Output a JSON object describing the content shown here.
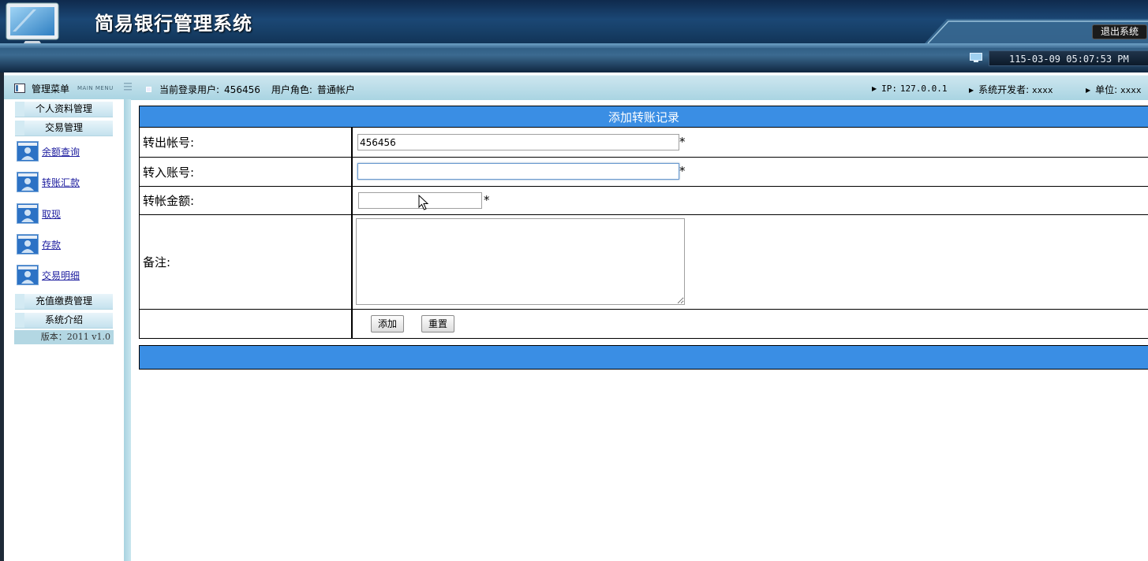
{
  "header": {
    "title": "简易银行管理系统",
    "logout_label": "退出系统",
    "datetime": "115-03-09 05:07:53 PM"
  },
  "infobar": {
    "menu_title": "管理菜单",
    "menu_title_en": "MAIN MENU",
    "current_user_label": "当前登录用户:",
    "current_user": "456456",
    "role_label": "用户角色:",
    "role": "普通帐户",
    "ip_label": "IP:",
    "ip": "127.0.0.1",
    "developer_label": "系统开发者:",
    "developer": "xxxx",
    "unit_label": "单位:",
    "unit": "xxxx"
  },
  "sidebar": {
    "categories": [
      {
        "label": "个人资料管理"
      },
      {
        "label": "交易管理"
      },
      {
        "label": "充值缴费管理"
      },
      {
        "label": "系统介绍"
      }
    ],
    "items": [
      {
        "label": "余额查询"
      },
      {
        "label": "转账汇款"
      },
      {
        "label": "取现"
      },
      {
        "label": "存款"
      },
      {
        "label": "交易明细"
      }
    ],
    "version": "版本：2011 v1.0"
  },
  "form": {
    "title": "添加转账记录",
    "from_account_label": "转出帐号:",
    "from_account_value": "456456",
    "to_account_label": "转入账号:",
    "to_account_value": "",
    "amount_label": "转帐金额:",
    "amount_value": "",
    "remark_label": "备注:",
    "required_mark": "*",
    "add_button": "添加",
    "reset_button": "重置"
  },
  "colors": {
    "form_header": "#3a8ee4",
    "header_bg": "#1b4775",
    "infobar_bg": "#a9d4e2"
  }
}
